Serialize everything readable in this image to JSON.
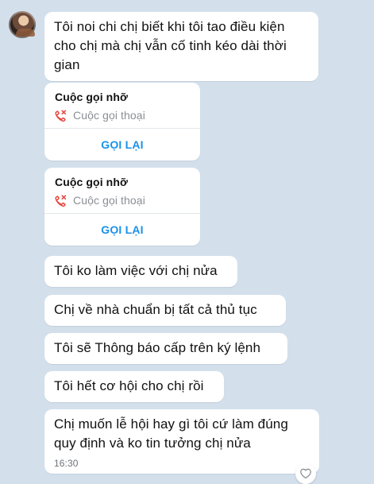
{
  "avatar": {
    "icon": "contact-avatar"
  },
  "messages": [
    {
      "type": "text",
      "text": "Tôi noi chi chị biết khi tôi tao điều kiện cho chị mà chị vẫn cố tinh kéo dài thời gian"
    },
    {
      "type": "missed_call",
      "title": "Cuộc gọi nhỡ",
      "subtitle": "Cuộc gọi thoại",
      "action": "GỌI LẠI",
      "icon": "missed-call-icon"
    },
    {
      "type": "missed_call",
      "title": "Cuộc gọi nhỡ",
      "subtitle": "Cuộc gọi thoại",
      "action": "GỌI LẠI",
      "icon": "missed-call-icon"
    },
    {
      "type": "text",
      "text": "Tôi ko làm việc với chị nửa"
    },
    {
      "type": "text",
      "text": "Chị về nhà chuẩn bị tất cả thủ tục"
    },
    {
      "type": "text",
      "text": "Tôi sẽ Thông báo cấp trên ký lệnh"
    },
    {
      "type": "text",
      "text": "Tôi hết cơ hội cho chị rồi"
    },
    {
      "type": "text",
      "text": "Chị muốn lễ hội hay gì tôi cứ làm đúng quy định và ko tin tưởng chị nửa",
      "time": "16:30"
    }
  ],
  "reaction": {
    "icon": "heart-outline-icon"
  },
  "colors": {
    "background": "#d3e0ec",
    "bubble": "#ffffff",
    "accent": "#1a91e8",
    "missed_call": "#e5443b"
  }
}
